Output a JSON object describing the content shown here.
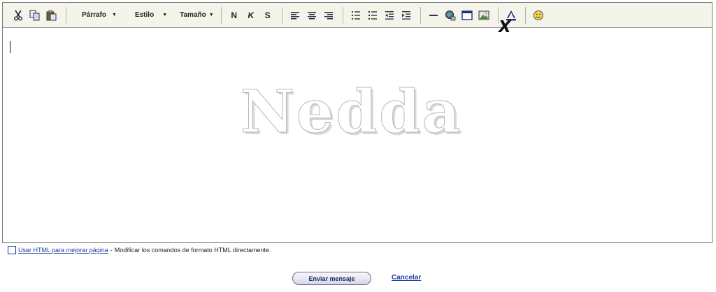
{
  "toolbar": {
    "paragraph_label": "Párrafo",
    "style_label": "Estilo",
    "size_label": "Tamaño",
    "bold_label": "N",
    "italic_label": "K",
    "strike_label": "S",
    "icons": [
      "cut-icon",
      "copy-icon",
      "paste-icon",
      "align-left-icon",
      "align-center-icon",
      "align-right-icon",
      "numbered-list-icon",
      "bullet-list-icon",
      "outdent-icon",
      "indent-icon",
      "horizontal-rule-icon",
      "link-icon",
      "table-icon",
      "image-icon",
      "text-color-icon",
      "emoticon-icon"
    ]
  },
  "editor": {
    "watermark": "Nedda",
    "mark": "X"
  },
  "html_option": {
    "link_text": "Usar HTML para mejorar página",
    "separator": "-",
    "description": "Modificar los comandos de formato HTML directamente."
  },
  "actions": {
    "send_label": "Enviar mensaje",
    "cancel_label": "Cancelar"
  },
  "colors": {
    "toolbar_bg": "#f4f4ea",
    "link": "#1a3e9c",
    "border": "#7a7a7a"
  }
}
